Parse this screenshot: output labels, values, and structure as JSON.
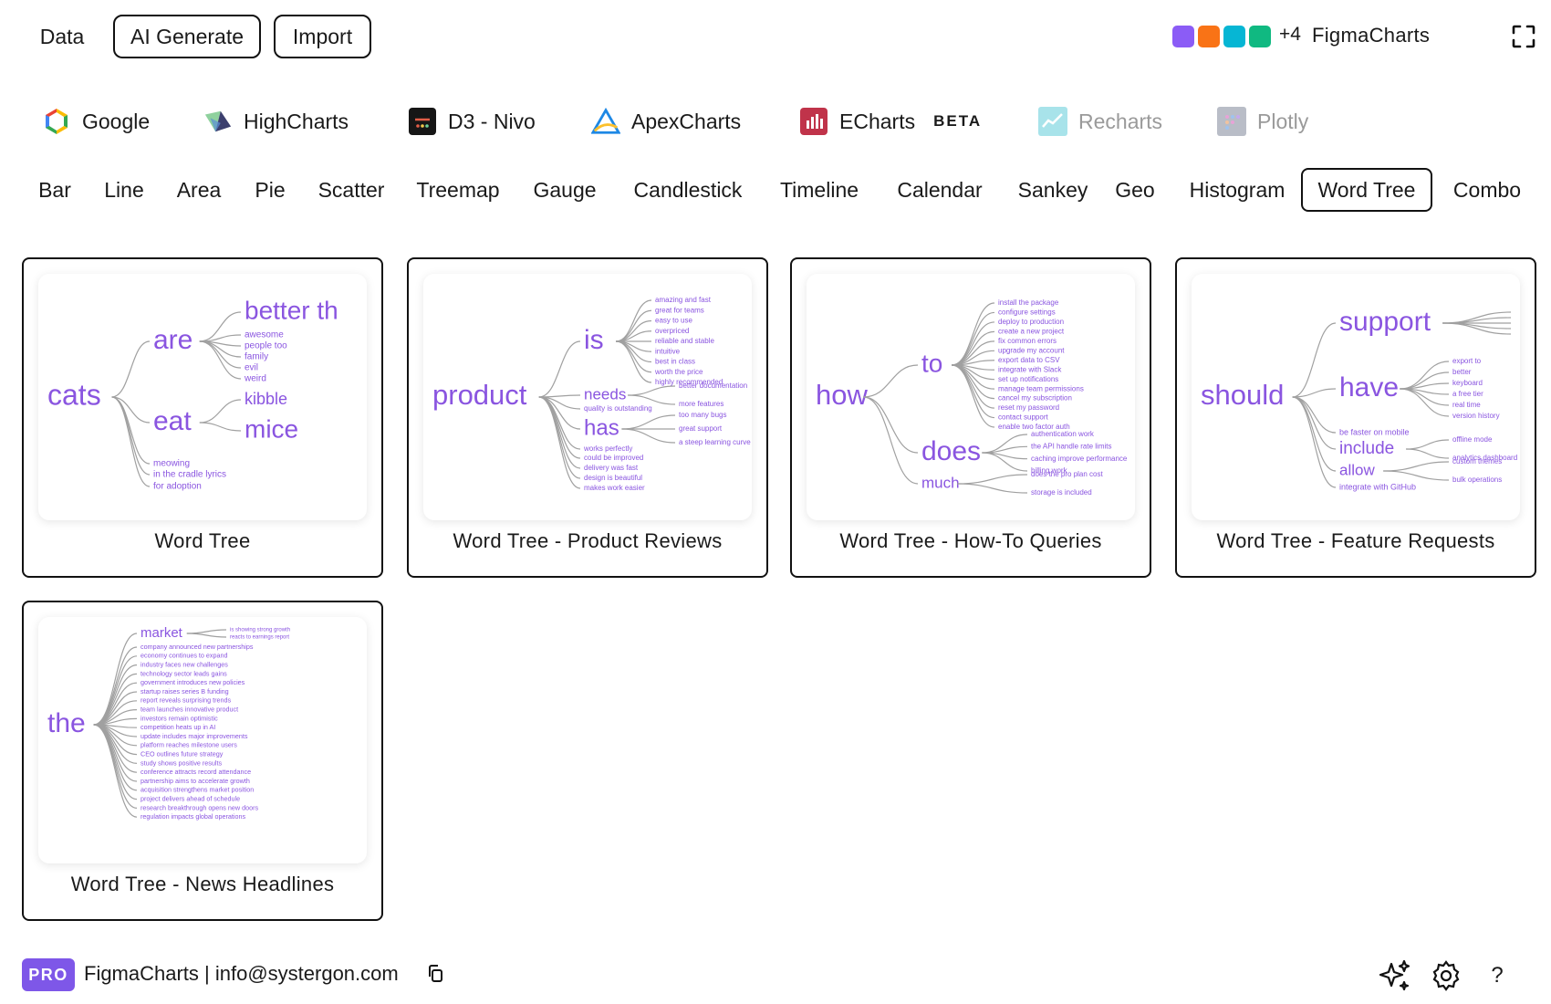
{
  "topbar": {
    "data_label": "Data",
    "ai_label": "AI Generate",
    "import_label": "Import",
    "swatch_colors": [
      "#8b5cf6",
      "#f97316",
      "#06b6d4",
      "#10b981"
    ],
    "more_count": "+4",
    "brand": "FigmaCharts",
    "fullscreen_icon": "fullscreen-icon"
  },
  "libraries": [
    {
      "label": "Google",
      "icon": "google-icon",
      "dim": false
    },
    {
      "label": "HighCharts",
      "icon": "highcharts-icon",
      "dim": false
    },
    {
      "label": "D3 - Nivo",
      "icon": "nivo-icon",
      "dim": false
    },
    {
      "label": "ApexCharts",
      "icon": "apexcharts-icon",
      "dim": false
    },
    {
      "label": "ECharts",
      "icon": "echarts-icon",
      "dim": false,
      "badge": "BETA"
    },
    {
      "label": "Recharts",
      "icon": "recharts-icon",
      "dim": true
    },
    {
      "label": "Plotly",
      "icon": "plotly-icon",
      "dim": true
    }
  ],
  "chart_types": [
    "Bar",
    "Line",
    "Area",
    "Pie",
    "Scatter",
    "Treemap",
    "Gauge",
    "Candlestick",
    "Timeline",
    "Calendar",
    "Sankey",
    "Geo",
    "Histogram",
    "Word Tree",
    "Combo"
  ],
  "active_type": "Word Tree",
  "colors": {
    "accent": "#8b5cf6",
    "word": "#8a55e0",
    "branch": "#a0a0a0",
    "pro": "#7e57e8"
  },
  "cards": [
    {
      "title": "Word Tree",
      "root": "cats",
      "branches": [
        {
          "word": "are",
          "children": [
            {
              "word": "better th",
              "big": true
            },
            {
              "word": "awesome"
            },
            {
              "word": "people too"
            },
            {
              "word": "family"
            },
            {
              "word": "evil"
            },
            {
              "word": "weird"
            }
          ]
        },
        {
          "word": "eat",
          "children": [
            {
              "word": "kibble",
              "mid": true
            },
            {
              "word": "mice",
              "big": true
            }
          ]
        }
      ],
      "leaves": [
        "meowing",
        "in the cradle lyrics",
        "for adoption"
      ]
    },
    {
      "title": "Word Tree - Product Reviews",
      "root": "product",
      "branches": [
        {
          "word": "is",
          "children": [
            {
              "word": "amazing and fast"
            },
            {
              "word": "great for teams"
            },
            {
              "word": "easy to use"
            },
            {
              "word": "overpriced"
            },
            {
              "word": "reliable and stable"
            },
            {
              "word": "intuitive"
            },
            {
              "word": "best in class"
            },
            {
              "word": "worth the price"
            },
            {
              "word": "highly recommended"
            }
          ]
        },
        {
          "word": "needs",
          "children": [
            {
              "word": "better documentation"
            },
            {
              "word": "more features"
            }
          ]
        },
        {
          "word": "has",
          "children": [
            {
              "word": "too many bugs"
            },
            {
              "word": "great support"
            },
            {
              "word": "a steep learning curve"
            }
          ]
        }
      ],
      "leaves": [
        "quality is outstanding",
        "works perfectly",
        "could be improved",
        "delivery was fast",
        "design is beautiful",
        "makes work easier"
      ]
    },
    {
      "title": "Word Tree - How-To Queries",
      "root": "how",
      "branches": [
        {
          "word": "to",
          "children": [
            {
              "word": "install the package"
            },
            {
              "word": "configure settings"
            },
            {
              "word": "deploy to production"
            },
            {
              "word": "create a new project"
            },
            {
              "word": "fix common errors"
            },
            {
              "word": "upgrade my account"
            },
            {
              "word": "export data to CSV"
            },
            {
              "word": "integrate with Slack"
            },
            {
              "word": "set up notifications"
            },
            {
              "word": "manage team permissions"
            },
            {
              "word": "cancel my subscription"
            },
            {
              "word": "reset my password"
            },
            {
              "word": "contact support"
            },
            {
              "word": "enable two factor auth"
            }
          ]
        },
        {
          "word": "does",
          "children": [
            {
              "word": "authentication work"
            },
            {
              "word": "the API handle rate limits"
            },
            {
              "word": "caching improve performance"
            },
            {
              "word": "billing work"
            }
          ]
        },
        {
          "word": "much",
          "children": [
            {
              "word": "does the pro plan cost"
            },
            {
              "word": "storage is included"
            }
          ]
        }
      ],
      "leaves": []
    },
    {
      "title": "Word Tree - Feature Requests",
      "root": "should",
      "branches": [
        {
          "word": "support",
          "children": []
        },
        {
          "word": "have",
          "children": [
            {
              "word": "export to"
            },
            {
              "word": "better"
            },
            {
              "word": "keyboard"
            },
            {
              "word": "a free tier"
            },
            {
              "word": "real time"
            },
            {
              "word": "version history"
            }
          ]
        },
        {
          "word": "include",
          "children": [
            {
              "word": "offline mode"
            },
            {
              "word": "analytics dashboard"
            }
          ]
        },
        {
          "word": "allow",
          "children": [
            {
              "word": "custom themes"
            },
            {
              "word": "bulk operations"
            }
          ]
        }
      ],
      "leaves": [
        "be faster on mobile",
        "integrate with GitHub"
      ]
    },
    {
      "title": "Word Tree - News Headlines",
      "root": "the",
      "branches": [
        {
          "word": "market",
          "children": [
            {
              "word": "is showing strong growth"
            },
            {
              "word": "reacts to earnings report"
            }
          ]
        }
      ],
      "leaves": [
        "company announced new partnerships",
        "economy continues to expand",
        "industry faces new challenges",
        "technology sector leads gains",
        "government introduces new policies",
        "startup raises series B funding",
        "report reveals surprising trends",
        "team launches innovative product",
        "investors remain optimistic",
        "competition heats up in AI",
        "update includes major improvements",
        "platform reaches milestone users",
        "CEO outlines future strategy",
        "study shows positive results",
        "conference attracts record attendance",
        "partnership aims to accelerate growth",
        "acquisition strengthens market position",
        "project delivers ahead of schedule",
        "research breakthrough opens new doors",
        "regulation impacts global operations"
      ]
    }
  ],
  "footer": {
    "pro_label": "PRO",
    "contact": "FigmaCharts | info@systergon.com",
    "copy_icon": "copy-icon",
    "sparkle_icon": "sparkle-icon",
    "settings_icon": "gear-icon",
    "help_label": "?"
  }
}
